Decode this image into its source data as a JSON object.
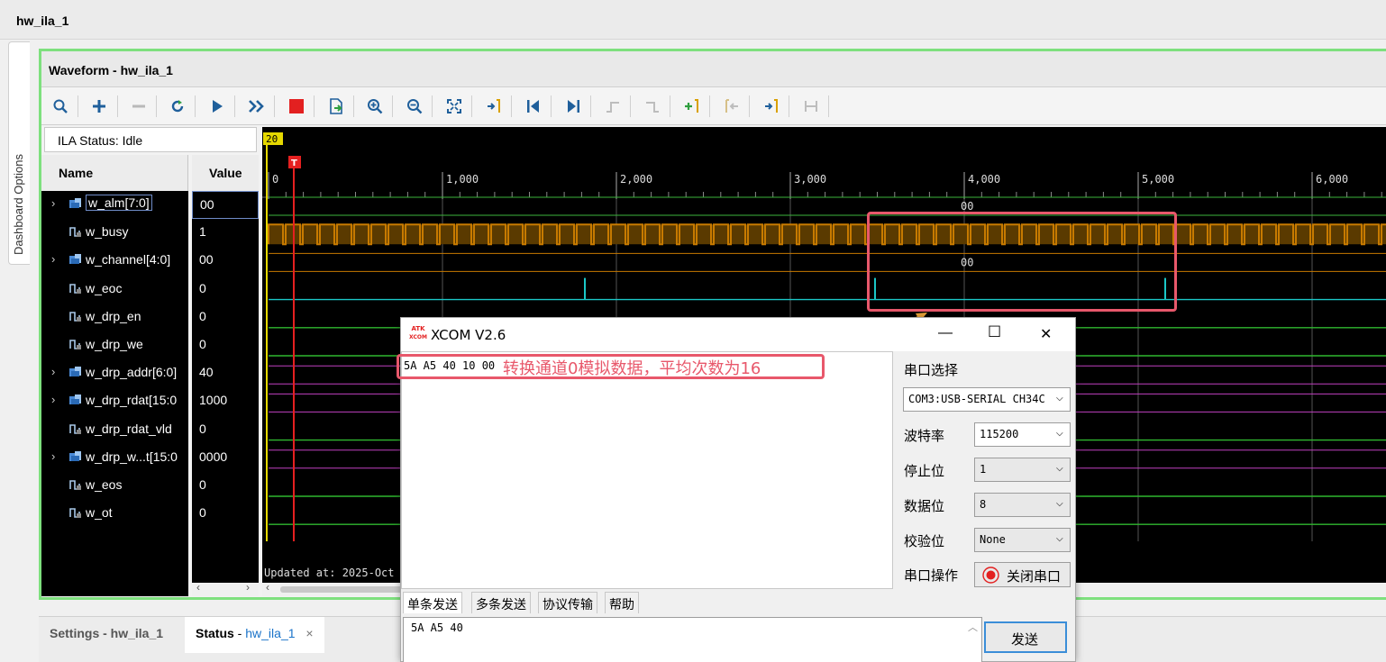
{
  "app": {
    "title": "hw_ila_1"
  },
  "side_tab": {
    "label": "Dashboard Options"
  },
  "waveform": {
    "title": "Waveform - hw_ila_1",
    "ila_status": "ILA Status: Idle",
    "columns": {
      "name": "Name",
      "value": "Value"
    },
    "signals": [
      {
        "name": "w_alm[7:0]",
        "value": "00",
        "bus": true
      },
      {
        "name": "w_busy",
        "value": "1",
        "bus": false
      },
      {
        "name": "w_channel[4:0]",
        "value": "00",
        "bus": true
      },
      {
        "name": "w_eoc",
        "value": "0",
        "bus": false
      },
      {
        "name": "w_drp_en",
        "value": "0",
        "bus": false
      },
      {
        "name": "w_drp_we",
        "value": "0",
        "bus": false
      },
      {
        "name": "w_drp_addr[6:0]",
        "value": "40",
        "bus": true
      },
      {
        "name": "w_drp_rdat[15:0",
        "value": "1000",
        "bus": true
      },
      {
        "name": "w_drp_rdat_vld",
        "value": "0",
        "bus": false
      },
      {
        "name": "w_drp_w...t[15:0",
        "value": "0000",
        "bus": true
      },
      {
        "name": "w_eos",
        "value": "0",
        "bus": false
      },
      {
        "name": "w_ot",
        "value": "0",
        "bus": false
      }
    ],
    "cursor_marker": "20",
    "trigger_marker": "T",
    "ruler_ticks": [
      "0",
      "1,000",
      "2,000",
      "3,000",
      "4,000",
      "5,000",
      "6,000"
    ],
    "bus_labels": {
      "w_alm": "00",
      "w_channel": "00"
    },
    "updated_text": "Updated at: 2025-Oct"
  },
  "toolbar_icons": [
    "search-icon",
    "plus-icon",
    "minus-icon",
    "refresh-icon",
    "run-icon",
    "run-fast-icon",
    "stop-icon",
    "export-icon",
    "zoom-in-icon",
    "zoom-out-icon",
    "zoom-fit-icon",
    "marker-icon",
    "go-start-icon",
    "go-end-icon",
    "prev-transition-icon",
    "next-transition-icon",
    "add-marker-icon",
    "prev-marker-icon",
    "next-marker-icon",
    "swap-icon"
  ],
  "bottom_tabs": [
    {
      "label": "Settings - hw_ila_1"
    },
    {
      "label_bold": "Status",
      "label_sep": " - ",
      "label_link": "hw_ila_1",
      "close": "×"
    }
  ],
  "xcom": {
    "title": "XCOM V2.6",
    "logo_top": "ATK",
    "logo_bottom": "XCOM",
    "window_buttons": {
      "minimize": "—",
      "maximize": "☐",
      "close": "✕"
    },
    "received": "5A A5 40 10 00",
    "annotation": "转换通道0模拟数据，平均次数为16",
    "port_label": "串口选择",
    "port_value": "COM3:USB-SERIAL CH34C",
    "baud_label": "波特率",
    "baud_value": "115200",
    "stop_label": "停止位",
    "stop_value": "1",
    "data_label": "数据位",
    "data_value": "8",
    "parity_label": "校验位",
    "parity_value": "None",
    "op_label": "串口操作",
    "op_button": "关闭串口",
    "tabs": [
      "单条发送",
      "多条发送",
      "协议传输",
      "帮助"
    ],
    "send_text": "5A A5 40",
    "send_button": "发送"
  },
  "colors": {
    "green_border": "#7ee07e",
    "annotation": "#e8586b",
    "bus_orange": "#c77a00",
    "cyan": "#1bc7c7",
    "magenta": "#c040c0"
  }
}
